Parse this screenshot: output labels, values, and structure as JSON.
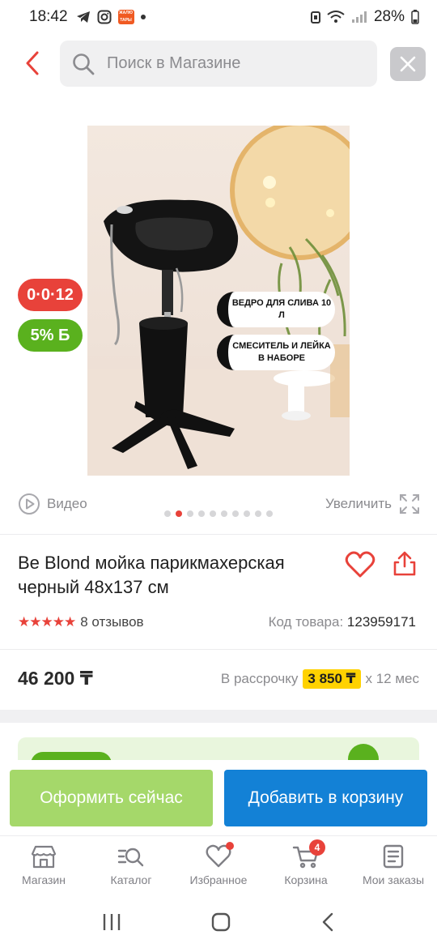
{
  "status_bar": {
    "time": "18:42",
    "badge_text": "ЖАЛЮ ТАРЫ",
    "battery": "28%"
  },
  "search": {
    "placeholder": "Поиск в Магазине"
  },
  "promos": {
    "installment_badge": "0·0·12",
    "bonus_badge": "5% Б"
  },
  "hero_image": {
    "callout_1": "ВЕДРО ДЛЯ СЛИВА 10 Л",
    "callout_2": "СМЕСИТЕЛЬ И ЛЕЙКА В НАБОРЕ",
    "carousel_total": 10,
    "carousel_active": 2
  },
  "media": {
    "video_label": "Видео",
    "zoom_label": "Увеличить"
  },
  "product": {
    "title": "Be Blond мойка парикмахерская черный 48x137 см",
    "stars": "★★★★★",
    "reviews": "8 отзывов",
    "sku_label": "Код товара:",
    "sku_value": "123959171",
    "price": "46 200 ₸",
    "installment_prefix": "В рассрочку",
    "installment_amount": "3 850 ₸",
    "installment_suffix": "x 12 мес"
  },
  "actions": {
    "buy_now": "Оформить сейчас",
    "add_to_cart": "Добавить в корзину"
  },
  "tabs": [
    {
      "label": "Магазин",
      "icon": "store-icon"
    },
    {
      "label": "Каталог",
      "icon": "catalog-search-icon"
    },
    {
      "label": "Избранное",
      "icon": "heart-icon"
    },
    {
      "label": "Корзина",
      "icon": "cart-icon",
      "badge": "4"
    },
    {
      "label": "Мои заказы",
      "icon": "orders-icon"
    }
  ],
  "colors": {
    "accent_red": "#e8423a",
    "cta_green": "#a5d86a",
    "cta_blue": "#1381d6",
    "bonus_green": "#5ab11e",
    "installment_yellow": "#ffd200"
  }
}
